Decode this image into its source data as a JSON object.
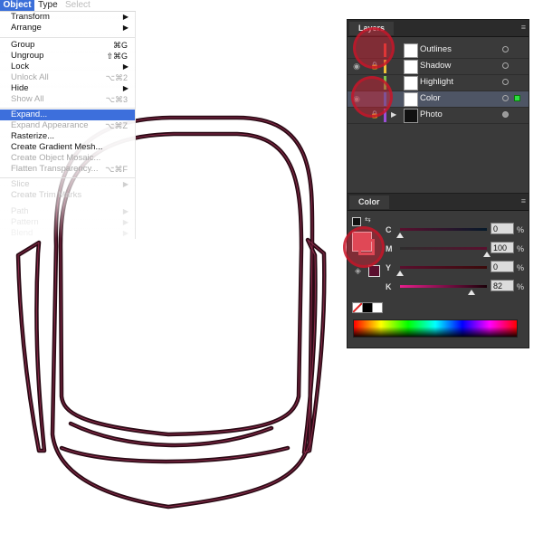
{
  "menubar": {
    "object": "Object",
    "type": "Type",
    "select": "Select"
  },
  "menu": {
    "items": [
      {
        "label": "Transform",
        "shortcut": "",
        "arrow": "▶"
      },
      {
        "label": "Arrange",
        "shortcut": "",
        "arrow": "▶"
      },
      {
        "label": "Group",
        "shortcut": "⌘G",
        "arrow": ""
      },
      {
        "label": "Ungroup",
        "shortcut": "⇧⌘G",
        "arrow": ""
      },
      {
        "label": "Lock",
        "shortcut": "",
        "arrow": "▶"
      },
      {
        "label": "Unlock All",
        "shortcut": "⌥⌘2",
        "arrow": ""
      },
      {
        "label": "Hide",
        "shortcut": "",
        "arrow": "▶"
      },
      {
        "label": "Show All",
        "shortcut": "⌥⌘3",
        "arrow": ""
      },
      {
        "label": "Expand...",
        "shortcut": "",
        "arrow": ""
      },
      {
        "label": "Expand Appearance",
        "shortcut": "⌥⌘Z",
        "arrow": ""
      },
      {
        "label": "Rasterize...",
        "shortcut": "",
        "arrow": ""
      },
      {
        "label": "Create Gradient Mesh...",
        "shortcut": "",
        "arrow": ""
      },
      {
        "label": "Create Object Mosaic...",
        "shortcut": "",
        "arrow": ""
      },
      {
        "label": "Flatten Transparency...",
        "shortcut": "⌥⌘F",
        "arrow": ""
      },
      {
        "label": "Slice",
        "shortcut": "",
        "arrow": "▶"
      },
      {
        "label": "Create Trim Marks",
        "shortcut": "",
        "arrow": ""
      },
      {
        "label": "Path",
        "shortcut": "",
        "arrow": "▶"
      },
      {
        "label": "Pattern",
        "shortcut": "",
        "arrow": "▶"
      },
      {
        "label": "Blend",
        "shortcut": "",
        "arrow": "▶"
      }
    ]
  },
  "layers": {
    "tab": "Layers",
    "menu_icon": "≡",
    "rows": [
      {
        "name": "Outlines",
        "color": "#e8473a",
        "eye": "",
        "lock": ""
      },
      {
        "name": "Shadow",
        "color": "#f0c43a",
        "eye": "◉",
        "lock": "🔒"
      },
      {
        "name": "Highlight",
        "color": "#7ec64a",
        "eye": "",
        "lock": ""
      },
      {
        "name": "Color",
        "color": "#3a7ae8",
        "eye": "◉",
        "lock": ""
      },
      {
        "name": "Photo",
        "color": "#9b4fd8",
        "eye": "",
        "lock": "🔒"
      }
    ]
  },
  "color": {
    "tab": "Color",
    "menu_icon": "≡",
    "channels": [
      {
        "label": "C",
        "value": "0",
        "unit": "%",
        "level": 0
      },
      {
        "label": "M",
        "value": "100",
        "unit": "%",
        "level": 100
      },
      {
        "label": "Y",
        "value": "0",
        "unit": "%",
        "level": 0
      },
      {
        "label": "K",
        "value": "82",
        "unit": "%",
        "level": 82
      }
    ],
    "stroke_color": "#5a0f2e"
  },
  "artwork": {
    "stroke_outer": "#3a0f1c",
    "stroke_inner": "#7c1d36"
  }
}
